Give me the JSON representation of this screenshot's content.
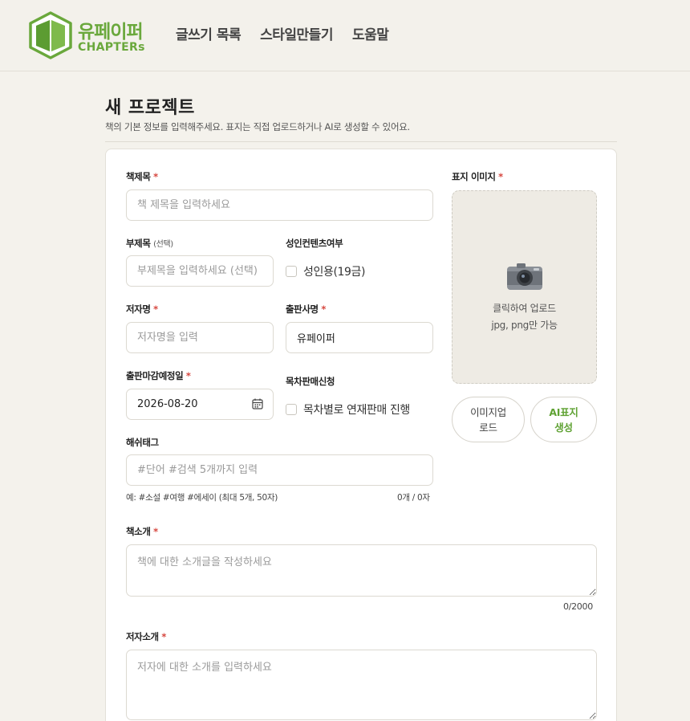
{
  "header": {
    "logo_ko": "유페이퍼",
    "logo_en": "CHAPTERs",
    "nav": [
      "글쓰기 목록",
      "스타일만들기",
      "도움말"
    ]
  },
  "page": {
    "title": "새 프로젝트",
    "description": "책의 기본 정보를 입력해주세요. 표지는 직접 업로드하거나 AI로 생성할 수 있어요."
  },
  "form": {
    "required_mark": "*",
    "title": {
      "label": "책제목",
      "placeholder": "책 제목을 입력하세요",
      "value": ""
    },
    "subtitle": {
      "label": "부제목",
      "label_hint": "(선택)",
      "placeholder": "부제목을 입력하세요 (선택)",
      "value": ""
    },
    "adult": {
      "label": "성인컨텐츠여부",
      "option": "성인용(19금)",
      "checked": false
    },
    "author": {
      "label": "저자명",
      "placeholder": "저자명을 입력",
      "value": ""
    },
    "publisher": {
      "label": "출판사명",
      "placeholder": "",
      "value": "유페이퍼"
    },
    "deadline": {
      "label": "출판마감예정일",
      "value": "2026-08-20"
    },
    "chapter_sale": {
      "label": "목차판매신청",
      "option": "목차별로 연재판매 진행",
      "checked": false
    },
    "hashtags": {
      "label": "해쉬태그",
      "placeholder": "#단어 #검색 5개까지 입력",
      "example": "예: #소설 #여행 #에세이 (최대 5개, 50자)",
      "counter": "0개 / 0자"
    },
    "intro": {
      "label": "책소개",
      "placeholder": "책에 대한 소개글을 작성하세요",
      "counter": "0/2000"
    },
    "author_intro": {
      "label": "저자소개",
      "placeholder": "저자에 대한 소개를 입력하세요"
    }
  },
  "cover": {
    "label": "표지 이미지",
    "upload_line1": "클릭하여 업로드",
    "upload_line2": "jpg, png만 가능",
    "btn_upload_1": "이미지업",
    "btn_upload_2": "로드",
    "btn_ai_1": "AI표지",
    "btn_ai_2": "생성"
  },
  "colors": {
    "brand_green": "#6aa83c",
    "required_red": "#d6453d",
    "background": "#f4f2ec"
  }
}
